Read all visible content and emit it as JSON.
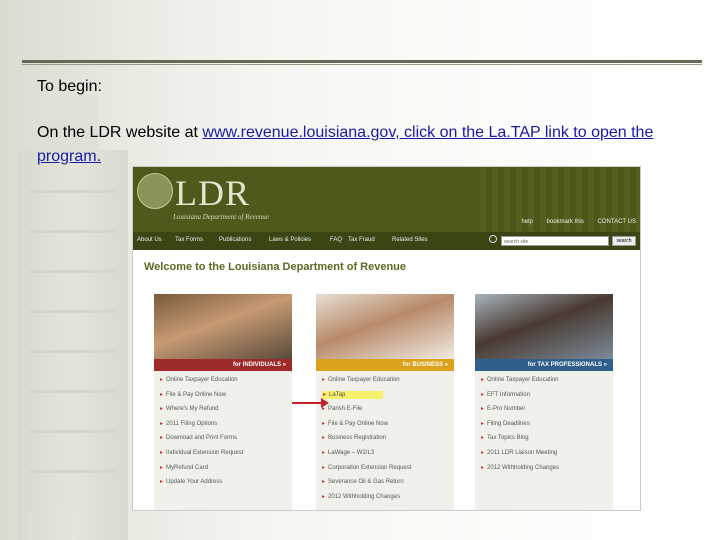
{
  "slide": {
    "heading": "To begin:",
    "para_prefix": "On the LDR website at ",
    "link": "www.revenue.louisiana.gov, click on the La.TAP link to open the program."
  },
  "site": {
    "logo": "LDR",
    "logo_sub": "Louisiana Department of Revenue",
    "top_links": [
      "help",
      "bookmark this",
      "CONTACT US"
    ],
    "nav": [
      "About Us",
      "Tax Forms",
      "Publications",
      "Laws & Policies",
      "FAQ",
      "Tax Fraud",
      "Related Sites"
    ],
    "search_placeholder": "search site",
    "search_button": "search",
    "welcome": "Welcome to the Louisiana Department of Revenue",
    "columns": [
      {
        "label": "for INDIVIDUALS »",
        "color": "#9e2a2a",
        "links": [
          "Online Taxpayer Education",
          "File & Pay Online Now",
          "Where's My Refund",
          "2011 Filing Options",
          "Download and Print Forms",
          "Individual Extension Request",
          "MyRefund Card",
          "Update Your Address"
        ]
      },
      {
        "label": "for BUSINESS »",
        "color": "#d9a21a",
        "links": [
          "Online Taxpayer Education",
          "LaTap",
          "Parish E-File",
          "File & Pay Online Now",
          "Business Registration",
          "LaWage – W2/L3",
          "Corporation Extension Request",
          "Severance Oil & Gas Return",
          "2012 Withholding Changes"
        ]
      },
      {
        "label": "for TAX PROFESSIONALS »",
        "color": "#2f5f8a",
        "links": [
          "Online Taxpayer Education",
          "EFT Information",
          "E-Pro Number",
          "Filing Deadlines",
          "Tax Topics Blog",
          "2011 LDR Liaison Meeting",
          "2012 Withholding Changes"
        ]
      }
    ]
  }
}
